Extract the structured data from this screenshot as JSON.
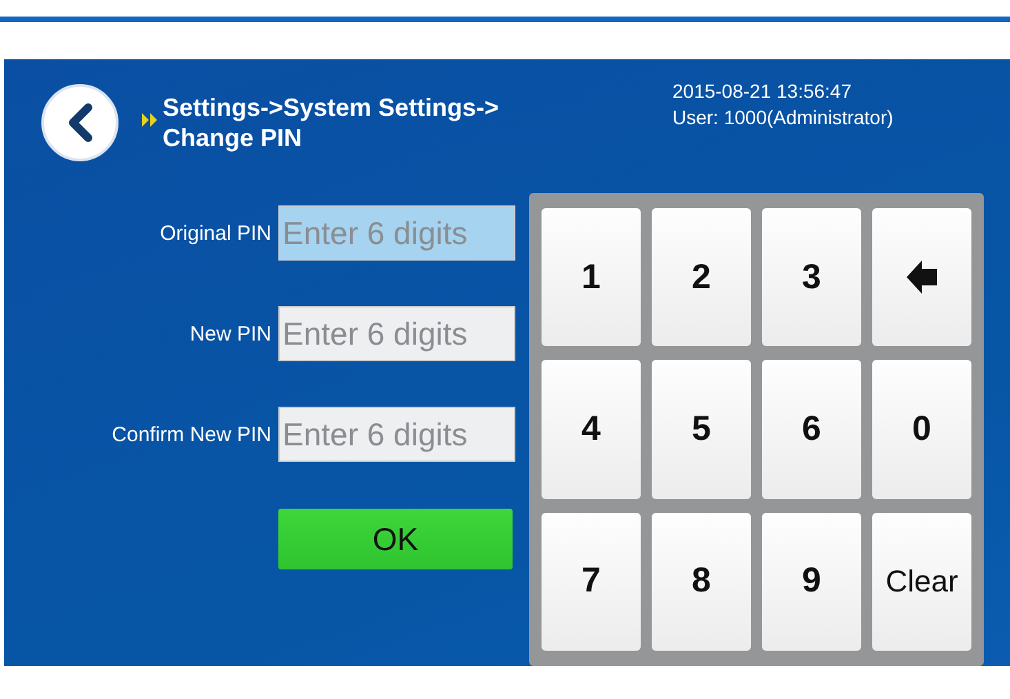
{
  "header": {
    "breadcrumb_line_1": "Settings->System Settings->",
    "breadcrumb_line_2": "Change PIN",
    "datetime": "2015-08-21  13:56:47",
    "user": "User: 1000(Administrator)"
  },
  "fields": [
    {
      "label": "Original PIN",
      "placeholder": "Enter 6 digits",
      "focused": true
    },
    {
      "label": "New PIN",
      "placeholder": "Enter 6 digits",
      "focused": false
    },
    {
      "label": "Confirm New PIN",
      "placeholder": "Enter 6 digits",
      "focused": false
    }
  ],
  "ok_button": "OK",
  "keypad": [
    {
      "kind": "digit",
      "label": "1"
    },
    {
      "kind": "digit",
      "label": "2"
    },
    {
      "kind": "digit",
      "label": "3"
    },
    {
      "kind": "backspace"
    },
    {
      "kind": "digit",
      "label": "4"
    },
    {
      "kind": "digit",
      "label": "5"
    },
    {
      "kind": "digit",
      "label": "6"
    },
    {
      "kind": "digit",
      "label": "0"
    },
    {
      "kind": "digit",
      "label": "7"
    },
    {
      "kind": "digit",
      "label": "8"
    },
    {
      "kind": "digit",
      "label": "9"
    },
    {
      "kind": "clear",
      "label": "Clear"
    }
  ]
}
